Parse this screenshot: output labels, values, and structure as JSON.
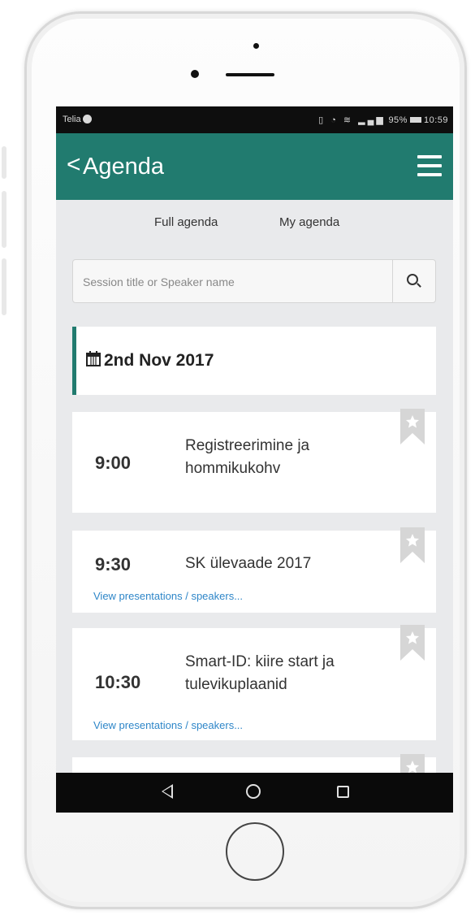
{
  "status_bar": {
    "carrier": "Telia",
    "icons_text": "Ωℂ ◔ ◈",
    "battery_pct": "95%",
    "time": "10:59"
  },
  "app_bar": {
    "back_glyph": "<",
    "title": "Agenda"
  },
  "tabs": [
    {
      "label": "Full agenda"
    },
    {
      "label": "My agenda"
    }
  ],
  "search": {
    "placeholder": "Session title or Speaker name",
    "value": ""
  },
  "date_header": {
    "label": "2nd Nov 2017"
  },
  "sessions": [
    {
      "time": "9:00",
      "title": "Registreerimine ja hommikukohv",
      "link": ""
    },
    {
      "time": "9:30",
      "title": "SK ülevaade 2017",
      "link": "View presentations / speakers..."
    },
    {
      "time": "10:30",
      "title": "Smart-ID: kiire start ja tulevikuplaanid",
      "link": "View presentations / speakers..."
    }
  ],
  "colors": {
    "accent": "#217b6f",
    "link": "#2e86c8",
    "background": "#e9eaec"
  },
  "icons": {
    "back": "chevron-left-icon",
    "menu": "hamburger-menu-icon",
    "search": "search-icon",
    "calendar": "calendar-icon",
    "bookmark": "bookmark-star-icon"
  }
}
